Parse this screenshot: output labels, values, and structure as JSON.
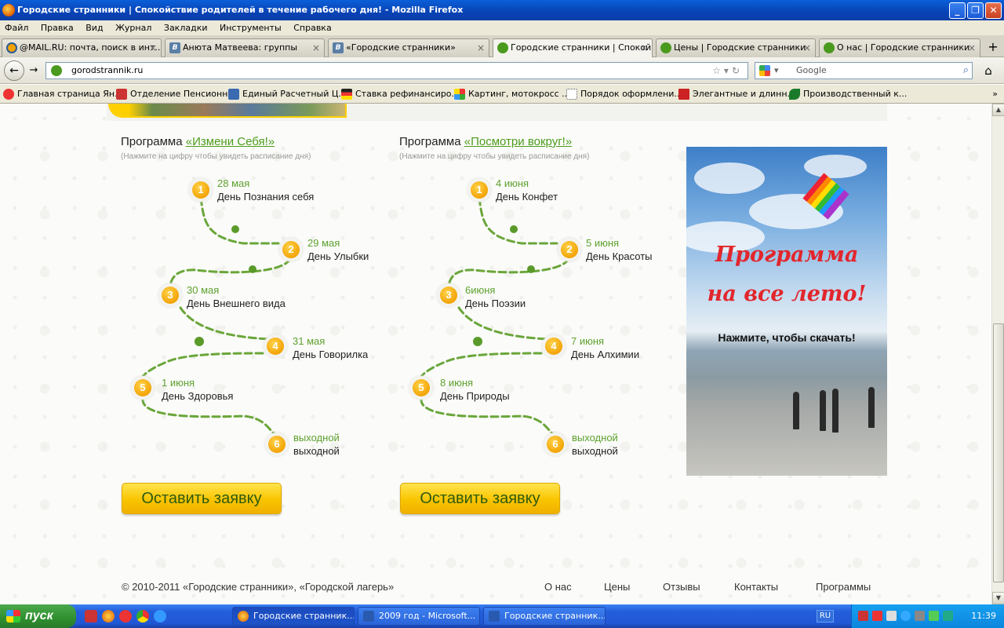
{
  "window": {
    "title": "Городские странники | Спокойствие родителей в течение рабочего дня! - Mozilla Firefox"
  },
  "menu": [
    "Файл",
    "Правка",
    "Вид",
    "Журнал",
    "Закладки",
    "Инструменты",
    "Справка"
  ],
  "tabs": [
    {
      "label": "@MAIL.RU: почта, поиск в инт...",
      "icon": "mailru-icon"
    },
    {
      "label": "Анюта Матвеева: группы",
      "icon": "vk-icon"
    },
    {
      "label": "«Городские странники»",
      "icon": "vk-icon"
    },
    {
      "label": "Городские странники | Спокой...",
      "icon": "frog-icon",
      "active": true
    },
    {
      "label": "Цены | Городские странники",
      "icon": "frog-icon"
    },
    {
      "label": "О нас | Городские странники",
      "icon": "frog-icon"
    }
  ],
  "nav": {
    "url": "gorodstrannik.ru",
    "search_placeholder": "Google"
  },
  "bookmarks": [
    "Главная страница Ян...",
    "Отделение Пенсионн...",
    "Единый Расчетный Ц...",
    "Ставка рефинансиро...",
    "Картинг, мотокросс ...",
    "Порядок оформлени...",
    "Элегантные и длинн...",
    "Производственный к..."
  ],
  "programs": [
    {
      "prefix": "Программа ",
      "name": "«Измени Себя!»",
      "hint": "(Нажмите на цифру чтобы увидеть расписание дня)",
      "days": [
        {
          "num": "1",
          "date": "28 мая",
          "name": "День Познания себя"
        },
        {
          "num": "2",
          "date": "29 мая",
          "name": "День Улыбки"
        },
        {
          "num": "3",
          "date": "30 мая",
          "name": "День Внешнего вида"
        },
        {
          "num": "4",
          "date": "31 мая",
          "name": "День Говорилка"
        },
        {
          "num": "5",
          "date": "1 июня",
          "name": "День Здоровья"
        },
        {
          "num": "6",
          "date": "выходной",
          "name": "выходной"
        }
      ],
      "button": "Оставить заявку"
    },
    {
      "prefix": "Программа ",
      "name": "«Посмотри вокруг!»",
      "hint": "(Нажмите на цифру чтобы увидеть расписание дня)",
      "days": [
        {
          "num": "1",
          "date": "4 июня",
          "name": "День Конфет"
        },
        {
          "num": "2",
          "date": "5 июня",
          "name": "День Красоты"
        },
        {
          "num": "3",
          "date": "6июня",
          "name": "День Поэзии"
        },
        {
          "num": "4",
          "date": "7 июня",
          "name": "День Алхимии"
        },
        {
          "num": "5",
          "date": "8 июня",
          "name": "День Природы"
        },
        {
          "num": "6",
          "date": "выходной",
          "name": "выходной"
        }
      ],
      "button": "Оставить заявку"
    }
  ],
  "promo": {
    "line1": "Программа",
    "line2": "на все лето!",
    "line3": "Нажмите, чтобы скачать!"
  },
  "footer": {
    "copyright": "© 2010-2011 «Городские странники», «Городской лагерь»",
    "links": [
      "О нас",
      "Цены",
      "Отзывы",
      "Контакты",
      "Программы"
    ]
  },
  "taskbar": {
    "start": "пуск",
    "tasks": [
      "Городские странник...",
      "2009 год - Microsoft...",
      "Городские странник..."
    ],
    "lang": "RU",
    "time": "11:39"
  },
  "colors": {
    "accent_green": "#5da12e",
    "button_yellow": "#f9c400",
    "promo_red": "#e2262c"
  }
}
